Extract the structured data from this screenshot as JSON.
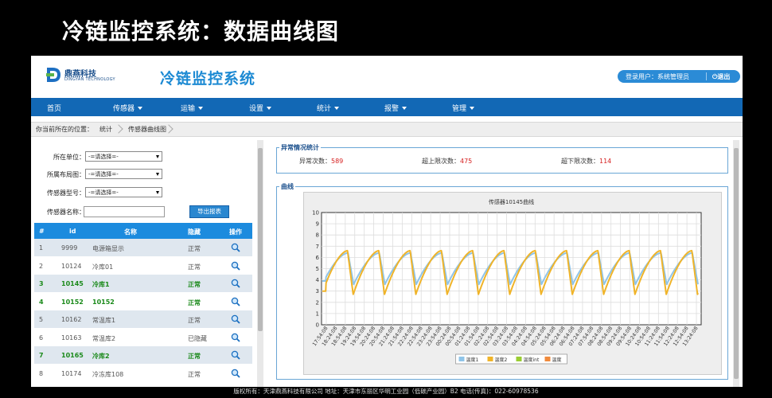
{
  "banner": {
    "title": "冷链监控系统：数据曲线图"
  },
  "header": {
    "logo_cn": "鼎燕科技",
    "logo_en": "DINGYAN TECHNOLOGY",
    "system_title": "冷链监控系统",
    "user_text": "登录用户：系统管理员",
    "logout_label": "退出"
  },
  "nav": {
    "items": [
      "首页",
      "传感器",
      "运输",
      "设置",
      "统计",
      "报警",
      "管理"
    ]
  },
  "breadcrumb": {
    "prefix": "你当前所在的位置：",
    "level1": "统计",
    "level2": "传感器曲线图"
  },
  "filters": {
    "unit_label": "所在单位：",
    "unit_value": "-=请选择=-",
    "layout_label": "所属布局图：",
    "layout_value": "-=请选择=-",
    "model_label": "传感器型号：",
    "model_value": "-=请选择=-",
    "name_label": "传感器名称：",
    "name_value": "",
    "export_label": "导出报表"
  },
  "table": {
    "columns": [
      "#",
      "id",
      "名称",
      "隐藏",
      "操作"
    ],
    "rows": [
      {
        "no": "1",
        "id": "9999",
        "name": "电源箱显示",
        "status": "正常",
        "highlight": false
      },
      {
        "no": "2",
        "id": "10124",
        "name": "冷库01",
        "status": "正常",
        "highlight": false
      },
      {
        "no": "3",
        "id": "10145",
        "name": "冷库1",
        "status": "正常",
        "highlight": true
      },
      {
        "no": "4",
        "id": "10152",
        "name": "10152",
        "status": "正常",
        "highlight": true
      },
      {
        "no": "5",
        "id": "10162",
        "name": "常温库1",
        "status": "正常",
        "highlight": false
      },
      {
        "no": "6",
        "id": "10163",
        "name": "常温库2",
        "status": "已隐藏",
        "highlight": false
      },
      {
        "no": "7",
        "id": "10165",
        "name": "冷库2",
        "status": "正常",
        "highlight": true
      },
      {
        "no": "8",
        "id": "10174",
        "name": "冷冻库108",
        "status": "正常",
        "highlight": false
      }
    ]
  },
  "stats": {
    "legend": "异常情况统计",
    "abnormal_label": "异常次数：",
    "abnormal_value": "589",
    "upper_label": "超上限次数：",
    "upper_value": "475",
    "lower_label": "超下限次数：",
    "lower_value": "114"
  },
  "curve_box": {
    "legend": "曲线"
  },
  "chart_data": {
    "type": "line",
    "title": "传感器10145曲线",
    "xlabel": "",
    "ylabel": "",
    "ylim": [
      0,
      10
    ],
    "yticks": [
      0,
      1,
      2,
      3,
      4,
      5,
      6,
      7,
      8,
      9,
      10
    ],
    "grid": true,
    "legend_position": "bottom",
    "x": [
      "17:54:08",
      "18:24:08",
      "18:54:08",
      "19:24:08",
      "19:54:08",
      "20:24:08",
      "20:54:08",
      "21:24:08",
      "21:54:08",
      "22:24:08",
      "22:54:08",
      "23:24:08",
      "23:54:08",
      "00:24:08",
      "00:54:08",
      "01:24:08",
      "01:54:08",
      "02:24:08",
      "02:54:08",
      "03:24:08",
      "03:54:08",
      "04:24:08",
      "04:54:08",
      "05:24:08",
      "05:54:08",
      "06:24:08",
      "06:54:08",
      "07:24:08",
      "07:54:08",
      "08:24:08",
      "08:54:08",
      "09:24:08",
      "09:54:08",
      "10:24:08",
      "10:54:08",
      "11:24:08",
      "11:54:08",
      "12:24:08",
      "12:54:08",
      "13:24:08"
    ],
    "series": [
      {
        "name": "温度1",
        "color": "#8fc4e8",
        "cycles": 12,
        "low": 3.6,
        "high": 6.4
      },
      {
        "name": "温度2",
        "color": "#f0b429",
        "cycles": 12,
        "low": 2.7,
        "high": 6.6
      },
      {
        "name": "温度int",
        "color": "#9acd32",
        "cycles": 0,
        "low": null,
        "high": null
      },
      {
        "name": "温度",
        "color": "#f08a3c",
        "cycles": 0,
        "low": null,
        "high": null
      }
    ]
  },
  "footer": {
    "text": "版权所有：天津鼎燕科技有限公司  地址：天津市东丽区华明工业园（低碳产业园）B2  电话(传真)：022-60978536"
  }
}
